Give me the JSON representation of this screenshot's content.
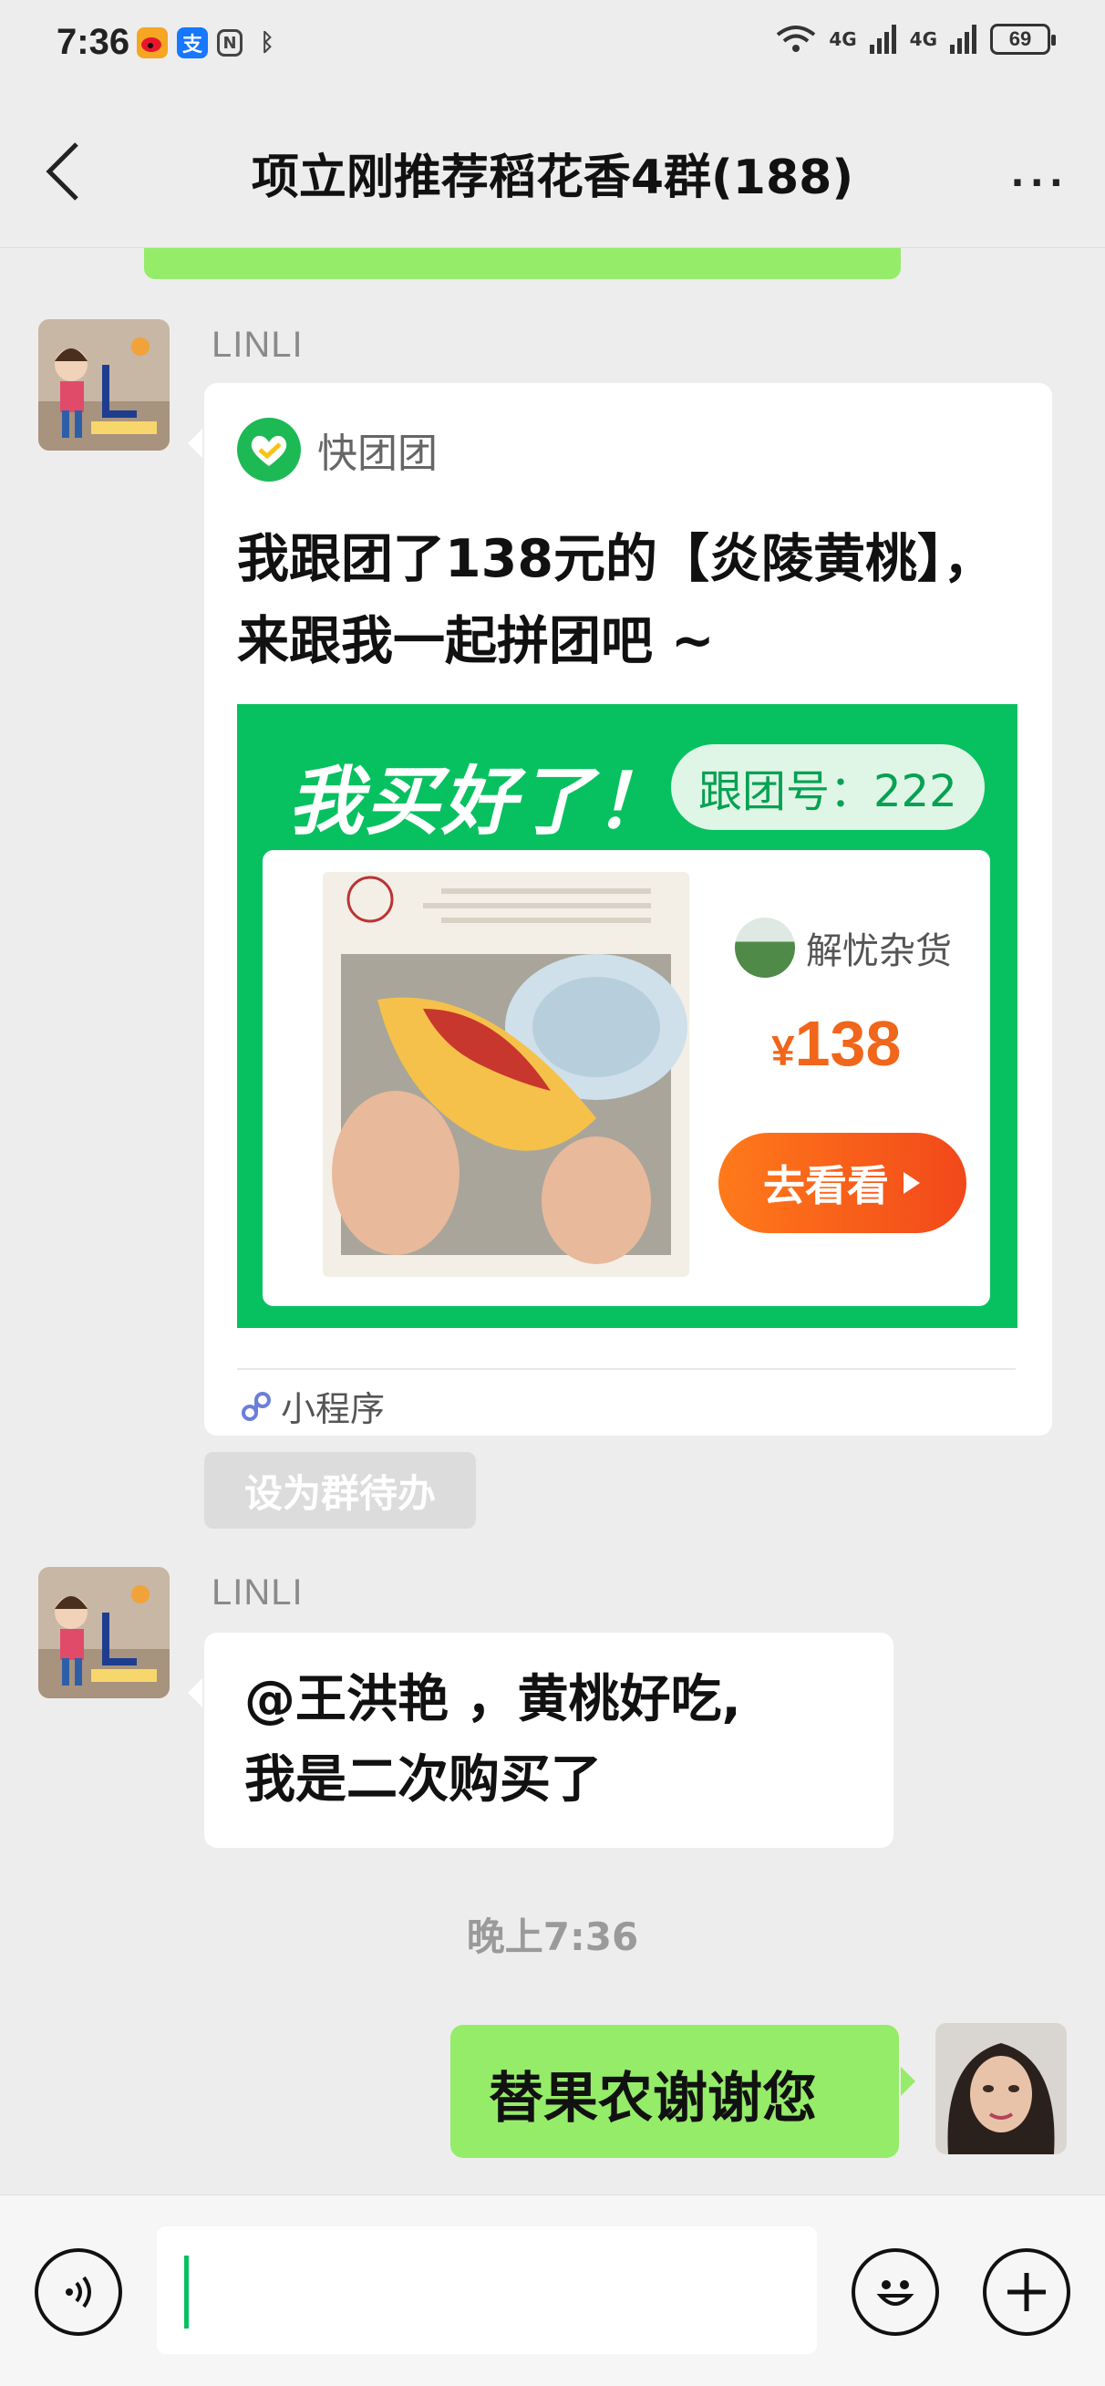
{
  "status_bar": {
    "time": "7:36",
    "battery": "69",
    "network_1": "4G",
    "network_2": "4G",
    "wifi_label": "6"
  },
  "nav": {
    "title": "项立刚推荐稻花香4群(188)",
    "more": "···"
  },
  "messages": [
    {
      "sender": "LINLI",
      "card": {
        "app_name": "快团团",
        "text": "我跟团了138元的【炎陵黄桃】，来跟我一起拼团吧 ~",
        "banner": "我买好了！",
        "tag": "跟团号：222",
        "store_name": "解忧杂货",
        "price_symbol": "¥",
        "price": "138",
        "button": "去看看",
        "footer": "小程序"
      },
      "action": "设为群待办"
    },
    {
      "sender": "LINLI",
      "text_line1": "@王洪艳 ，黄桃好吃,",
      "text_line2": "我是二次购买了"
    }
  ],
  "timestamp": "晚上7:36",
  "my_message": "替果农谢谢您",
  "colors": {
    "accent_green": "#07c160",
    "bubble_green": "#95ec69",
    "price_orange": "#f0661a"
  },
  "icons": [
    "back-icon",
    "more-icon",
    "voice-icon",
    "emoji-icon",
    "plus-icon",
    "mini-program-icon"
  ]
}
